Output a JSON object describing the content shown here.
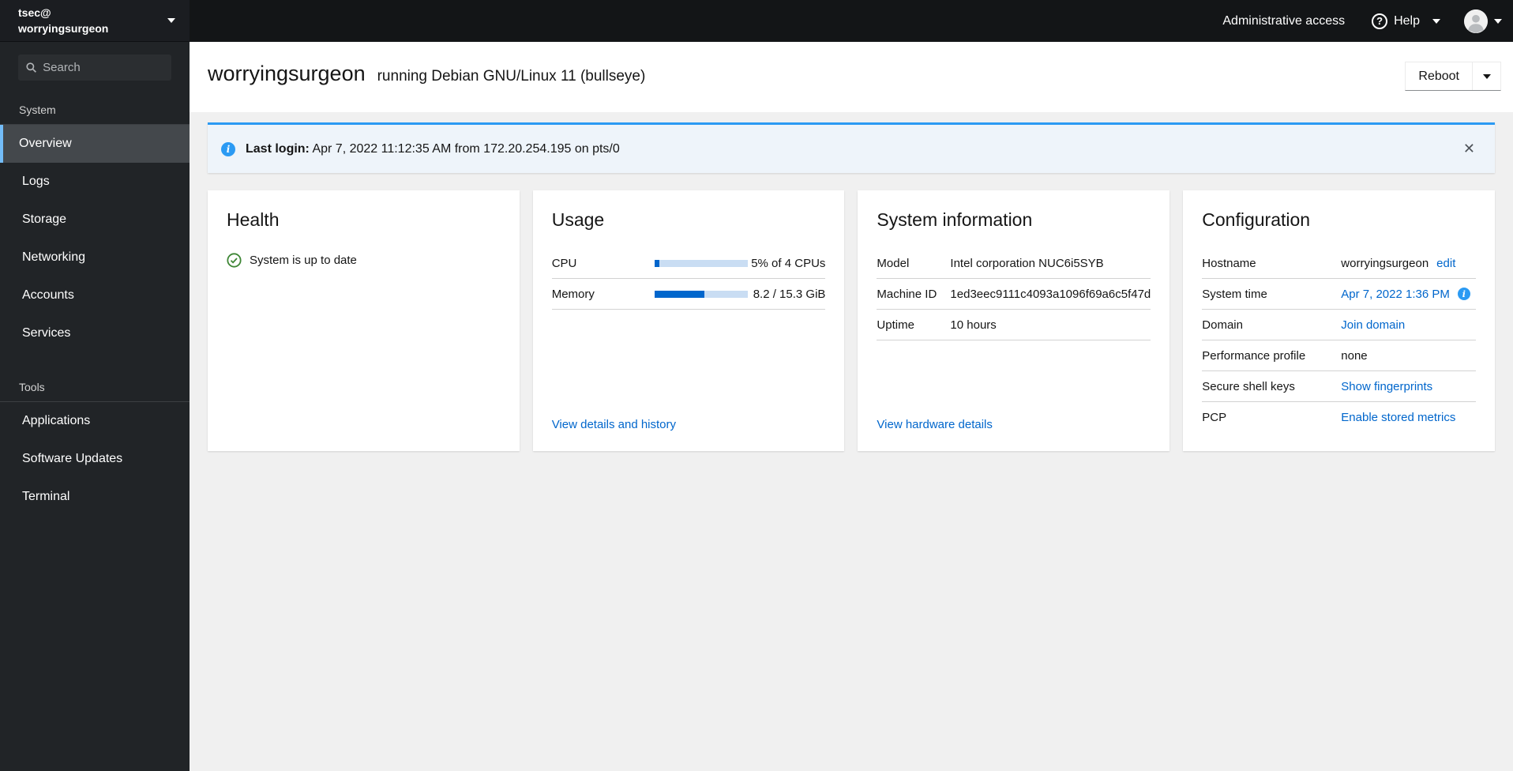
{
  "colors": {
    "accent_blue": "#0066cc",
    "alert_info_blue": "#2b9af3",
    "success_green": "#3e8635",
    "nav_active_indicator": "#73bcf7",
    "sidebar_bg": "#212427",
    "masthead_bg": "#131517",
    "content_bg": "#f0f0f0"
  },
  "sidebar": {
    "account_user": "tsec@",
    "account_host": "worryingsurgeon",
    "search_placeholder": "Search",
    "sections": [
      {
        "label": "System",
        "items": [
          "Overview",
          "Logs",
          "Storage",
          "Networking",
          "Accounts",
          "Services"
        ],
        "active_item": "Overview"
      },
      {
        "label": "Tools",
        "items": [
          "Applications",
          "Software Updates",
          "Terminal"
        ]
      }
    ]
  },
  "masthead": {
    "admin_access_label": "Administrative access",
    "help_label": "Help"
  },
  "page_header": {
    "hostname": "worryingsurgeon",
    "subtitle": "running Debian GNU/Linux 11 (bullseye)",
    "reboot_label": "Reboot"
  },
  "alert": {
    "title": "Last login:",
    "message": "Apr 7, 2022 11:12:35 AM from 172.20.254.195 on pts/0"
  },
  "cards": {
    "health": {
      "title": "Health",
      "status": "System is up to date"
    },
    "usage": {
      "title": "Usage",
      "rows": [
        {
          "label": "CPU",
          "percent": 5,
          "value": "5% of 4 CPUs"
        },
        {
          "label": "Memory",
          "percent": 54,
          "value": "8.2 / 15.3 GiB"
        }
      ],
      "link": "View details and history"
    },
    "system_info": {
      "title": "System information",
      "rows": [
        {
          "label": "Model",
          "value": "Intel corporation NUC6i5SYB"
        },
        {
          "label": "Machine ID",
          "value": "1ed3eec9111c4093a1096f69a6c5f47d"
        },
        {
          "label": "Uptime",
          "value": "10 hours"
        }
      ],
      "link": "View hardware details"
    },
    "configuration": {
      "title": "Configuration",
      "rows": [
        {
          "label": "Hostname",
          "value": "worryingsurgeon",
          "link": "edit"
        },
        {
          "label": "System time",
          "link": "Apr 7, 2022 1:36 PM"
        },
        {
          "label": "Domain",
          "link": "Join domain"
        },
        {
          "label": "Performance profile",
          "value": "none"
        },
        {
          "label": "Secure shell keys",
          "link": "Show fingerprints"
        },
        {
          "label": "PCP",
          "link": "Enable stored metrics"
        }
      ]
    }
  },
  "icons": {
    "info_glyph": "i",
    "close_glyph": "✕",
    "question_glyph": "?"
  }
}
